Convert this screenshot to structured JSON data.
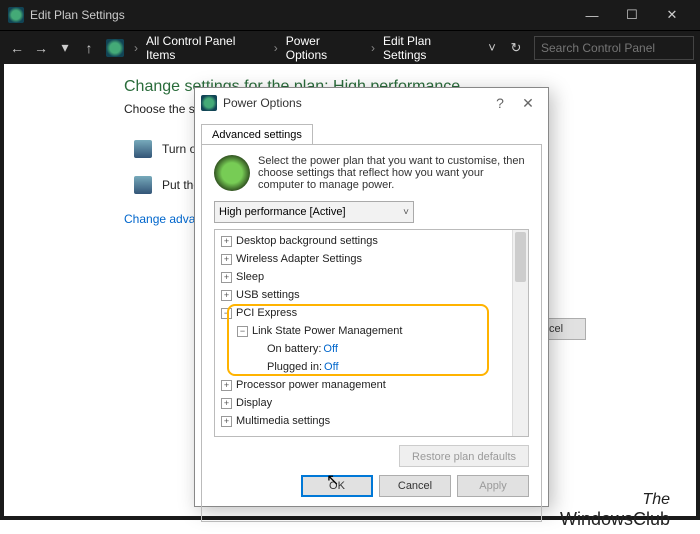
{
  "window": {
    "title": "Edit Plan Settings",
    "controls": {
      "min": "—",
      "max": "☐",
      "close": "✕"
    }
  },
  "toolbar": {
    "nav": {
      "back": "←",
      "fwd": "→",
      "hist": "▾",
      "up": "↑"
    },
    "crumbs": {
      "sep_first": "›",
      "c1": "All Control Panel Items",
      "c2": "Power Options",
      "c3": "Edit Plan Settings",
      "sep": "›"
    },
    "refresh": "↻",
    "dropdown": "˅",
    "search_placeholder": "Search Control Panel"
  },
  "page": {
    "heading": "Change settings for the plan: High performance",
    "subtext": "Choose the sleep and d",
    "opt1": "Turn off the display",
    "opt2": "Put the computer t",
    "link": "Change advanced pow",
    "bg_cancel": "Cancel"
  },
  "dialog": {
    "title": "Power Options",
    "help": "?",
    "close": "✕",
    "tab": "Advanced settings",
    "blurb": "Select the power plan that you want to customise, then choose settings that reflect how you want your computer to manage power.",
    "plan_dd": "High performance [Active]",
    "tree": {
      "plus": "+",
      "minus": "−",
      "n1": "Desktop background settings",
      "n2": "Wireless Adapter Settings",
      "n3": "Sleep",
      "n4": "USB settings",
      "n5": "PCI Express",
      "n5a": "Link State Power Management",
      "n5a1_k": "On battery:",
      "n5a1_v": "Off",
      "n5a2_k": "Plugged in:",
      "n5a2_v": "Off",
      "n6": "Processor power management",
      "n7": "Display",
      "n8": "Multimedia settings"
    },
    "restore": "Restore plan defaults",
    "ok": "OK",
    "cancel": "Cancel",
    "apply": "Apply"
  },
  "watermark": {
    "l1": "The",
    "l2": "WindowsClub"
  }
}
